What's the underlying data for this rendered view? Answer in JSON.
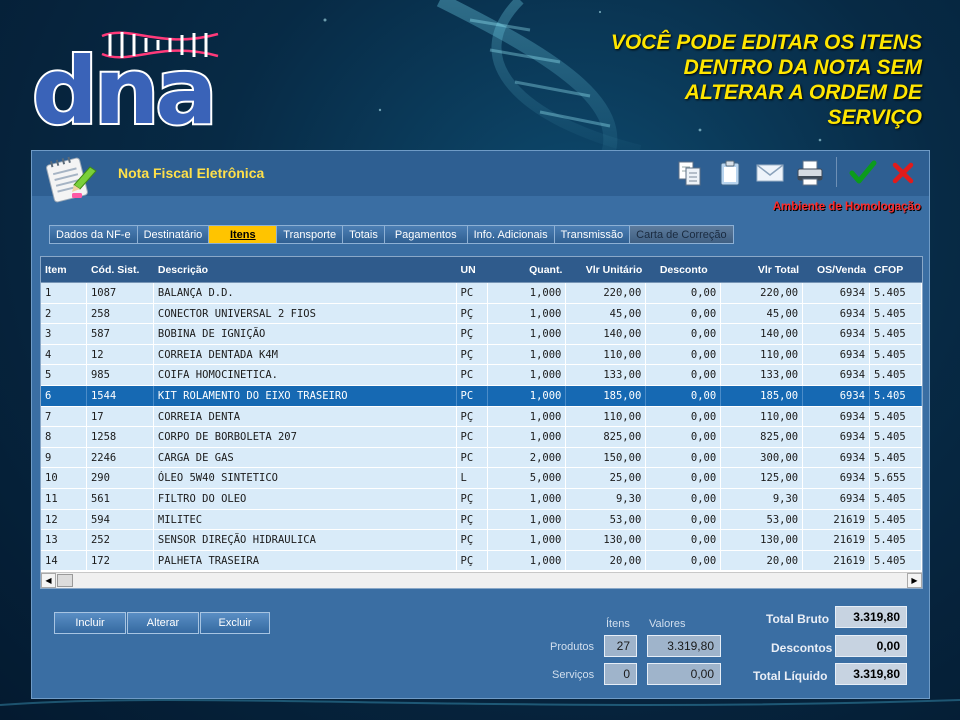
{
  "brand": {
    "logo_text": "dna"
  },
  "headline": "VOCÊ PODE EDITAR OS ITENS DENTRO DA NOTA SEM ALTERAR A ORDEM DE SERVIÇO",
  "window": {
    "title": "Nota Fiscal Eletrônica",
    "environment": "Ambiente de Homologação",
    "toolbar_icons": [
      "copy-icon",
      "clipboard-icon",
      "envelope-icon",
      "printer-icon",
      "check-icon",
      "close-icon"
    ]
  },
  "tabs": [
    {
      "label": "Dados da NF-e",
      "state": "normal"
    },
    {
      "label": "Destinatário",
      "state": "normal"
    },
    {
      "label": "Itens",
      "state": "active"
    },
    {
      "label": "Transporte",
      "state": "normal"
    },
    {
      "label": "Totais",
      "state": "normal"
    },
    {
      "label": "Pagamentos",
      "state": "normal"
    },
    {
      "label": "Info. Adicionais",
      "state": "normal"
    },
    {
      "label": "Transmissão",
      "state": "normal"
    },
    {
      "label": "Carta de Correção",
      "state": "disabled"
    }
  ],
  "grid": {
    "columns": [
      "Item",
      "Cód. Sist.",
      "Descrição",
      "UN",
      "Quant.",
      "Vlr Unitário",
      "Desconto",
      "Vlr Total",
      "OS/Venda",
      "CFOP"
    ],
    "selected_row": 5,
    "rows": [
      [
        "1",
        "1087",
        "BALANÇA D.D.",
        "PC",
        "1,000",
        "220,00",
        "0,00",
        "220,00",
        "6934",
        "5.405"
      ],
      [
        "2",
        "258",
        "CONECTOR UNIVERSAL 2 FIOS",
        "PÇ",
        "1,000",
        "45,00",
        "0,00",
        "45,00",
        "6934",
        "5.405"
      ],
      [
        "3",
        "587",
        "BOBINA DE IGNIÇÃO",
        "PÇ",
        "1,000",
        "140,00",
        "0,00",
        "140,00",
        "6934",
        "5.405"
      ],
      [
        "4",
        "12",
        "CORREIA DENTADA K4M",
        "PÇ",
        "1,000",
        "110,00",
        "0,00",
        "110,00",
        "6934",
        "5.405"
      ],
      [
        "5",
        "985",
        "COIFA HOMOCINETICA.",
        "PC",
        "1,000",
        "133,00",
        "0,00",
        "133,00",
        "6934",
        "5.405"
      ],
      [
        "6",
        "1544",
        "KIT ROLAMENTO DO EIXO TRASEIRO",
        "PC",
        "1,000",
        "185,00",
        "0,00",
        "185,00",
        "6934",
        "5.405"
      ],
      [
        "7",
        "17",
        "CORREIA DENTA",
        "PÇ",
        "1,000",
        "110,00",
        "0,00",
        "110,00",
        "6934",
        "5.405"
      ],
      [
        "8",
        "1258",
        "CORPO DE BORBOLETA 207",
        "PC",
        "1,000",
        "825,00",
        "0,00",
        "825,00",
        "6934",
        "5.405"
      ],
      [
        "9",
        "2246",
        "CARGA DE GAS",
        "PC",
        "2,000",
        "150,00",
        "0,00",
        "300,00",
        "6934",
        "5.405"
      ],
      [
        "10",
        "290",
        "ÓLEO 5W40 SINTETICO",
        "L",
        "5,000",
        "25,00",
        "0,00",
        "125,00",
        "6934",
        "5.655"
      ],
      [
        "11",
        "561",
        "FILTRO DO OLEO",
        "PÇ",
        "1,000",
        "9,30",
        "0,00",
        "9,30",
        "6934",
        "5.405"
      ],
      [
        "12",
        "594",
        "MILITEC",
        "PÇ",
        "1,000",
        "53,00",
        "0,00",
        "53,00",
        "21619",
        "5.405"
      ],
      [
        "13",
        "252",
        "SENSOR DIREÇÃO HIDRAULICA",
        "PÇ",
        "1,000",
        "130,00",
        "0,00",
        "130,00",
        "21619",
        "5.405"
      ],
      [
        "14",
        "172",
        "PALHETA TRASEIRA",
        "PÇ",
        "1,000",
        "20,00",
        "0,00",
        "20,00",
        "21619",
        "5.405"
      ]
    ]
  },
  "actions": {
    "incluir": "Incluir",
    "alterar": "Alterar",
    "excluir": "Excluir"
  },
  "summary": {
    "itens_label": "Ítens",
    "valores_label": "Valores",
    "produtos_label": "Produtos",
    "produtos_itens": "27",
    "produtos_valor": "3.319,80",
    "servicos_label": "Serviços",
    "servicos_itens": "0",
    "servicos_valor": "0,00",
    "total_bruto_label": "Total Bruto",
    "total_bruto": "3.319,80",
    "descontos_label": "Descontos",
    "descontos": "0,00",
    "total_liquido_label": "Total Líquido",
    "total_liquido": "3.319,80"
  }
}
